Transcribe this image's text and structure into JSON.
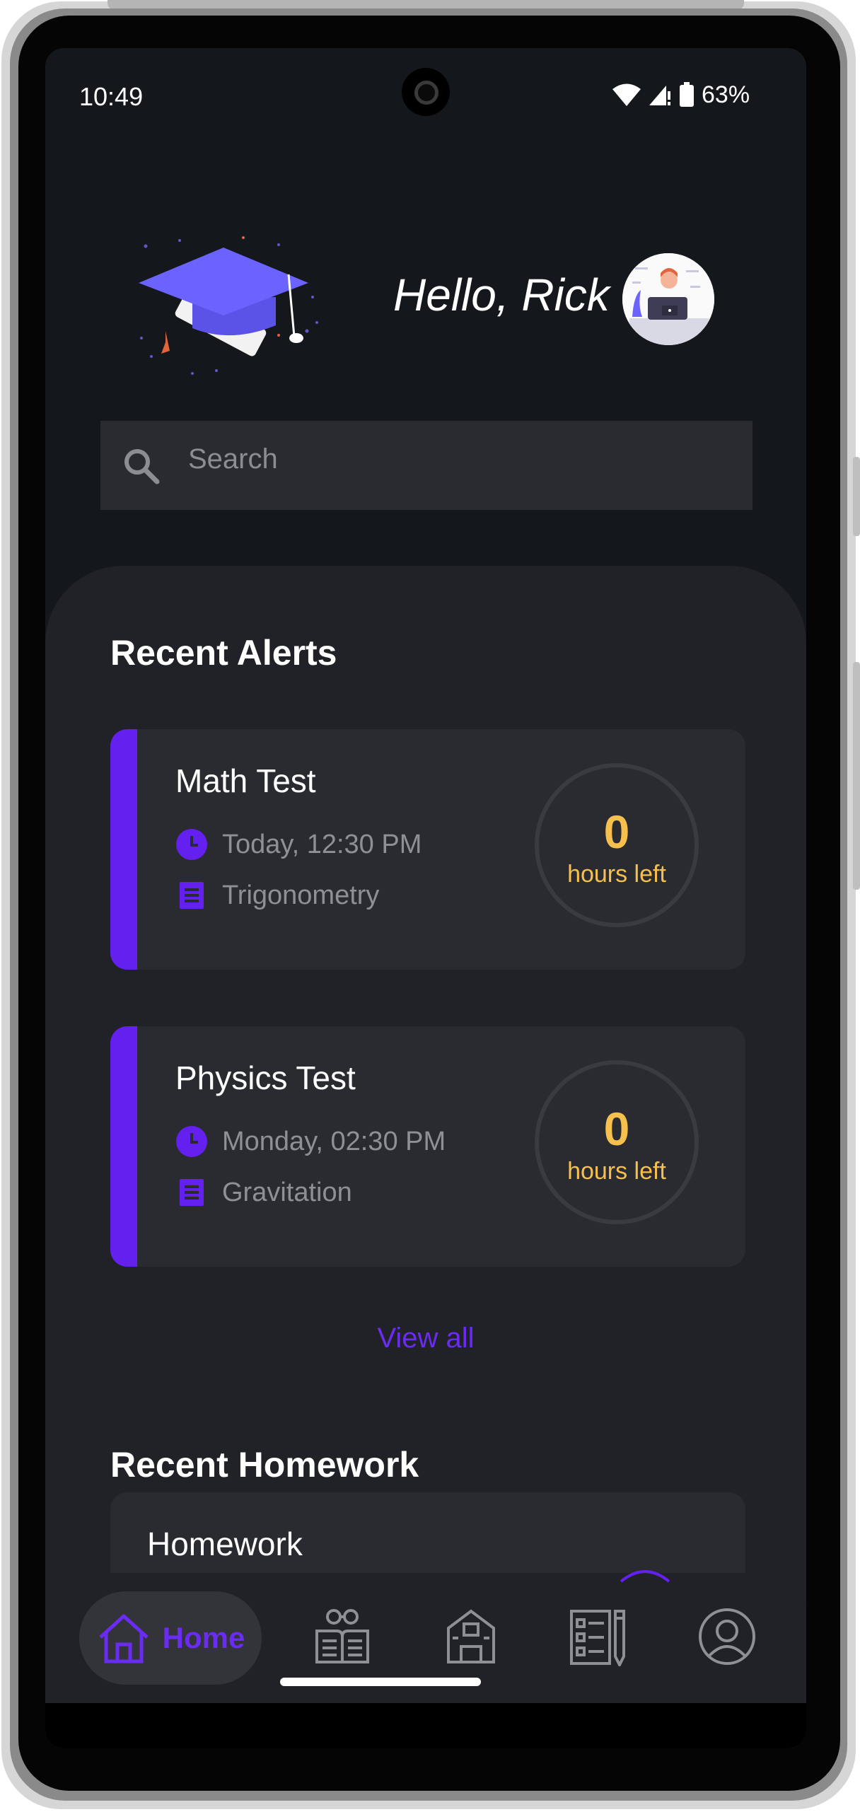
{
  "status_bar": {
    "time": "10:49",
    "battery": "63%"
  },
  "header": {
    "greeting": "Hello, Rick"
  },
  "search": {
    "placeholder": "Search"
  },
  "alerts": {
    "title": "Recent Alerts",
    "items": [
      {
        "title": "Math Test",
        "when": "Today, 12:30 PM",
        "topic": "Trigonometry",
        "count": "0",
        "count_label": "hours left"
      },
      {
        "title": "Physics Test",
        "when": "Monday, 02:30 PM",
        "topic": "Gravitation",
        "count": "0",
        "count_label": "hours left"
      }
    ],
    "view_all": "View all"
  },
  "homework": {
    "title": "Recent Homework",
    "items": [
      {
        "title": "Homework"
      }
    ]
  },
  "nav": {
    "items": [
      {
        "label": "Home",
        "icon": "home-icon",
        "active": true
      },
      {
        "label": "",
        "icon": "reading-icon"
      },
      {
        "label": "",
        "icon": "school-icon"
      },
      {
        "label": "",
        "icon": "checklist-icon"
      },
      {
        "label": "",
        "icon": "profile-icon"
      }
    ]
  },
  "colors": {
    "accent": "#6320ee",
    "countdown": "#f5c04d",
    "background": "#14171c",
    "card": "#2a2b31"
  }
}
